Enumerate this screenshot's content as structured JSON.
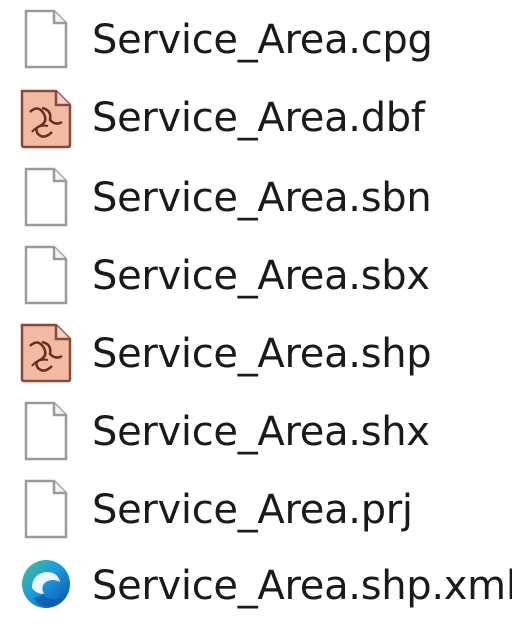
{
  "files": [
    {
      "name": "Service_Area.cpg",
      "icon": "blank-file-icon"
    },
    {
      "name": "Service_Area.dbf",
      "icon": "arcgis-file-icon"
    },
    {
      "name": "Service_Area.sbn",
      "icon": "blank-file-icon"
    },
    {
      "name": "Service_Area.sbx",
      "icon": "blank-file-icon"
    },
    {
      "name": "Service_Area.shp",
      "icon": "arcgis-file-icon"
    },
    {
      "name": "Service_Area.shx",
      "icon": "blank-file-icon"
    },
    {
      "name": "Service_Area.prj",
      "icon": "blank-file-icon"
    },
    {
      "name": "Service_Area.shp.xml",
      "icon": "edge-browser-icon"
    }
  ],
  "colors": {
    "text": "#1a1a1a",
    "arcgis_icon_fill": "#f2b9a3",
    "arcgis_icon_stroke": "#8a4a3a",
    "blank_icon_stroke": "#9a9a9a",
    "edge_blue": "#0c70c8",
    "edge_green": "#4bc28a"
  }
}
